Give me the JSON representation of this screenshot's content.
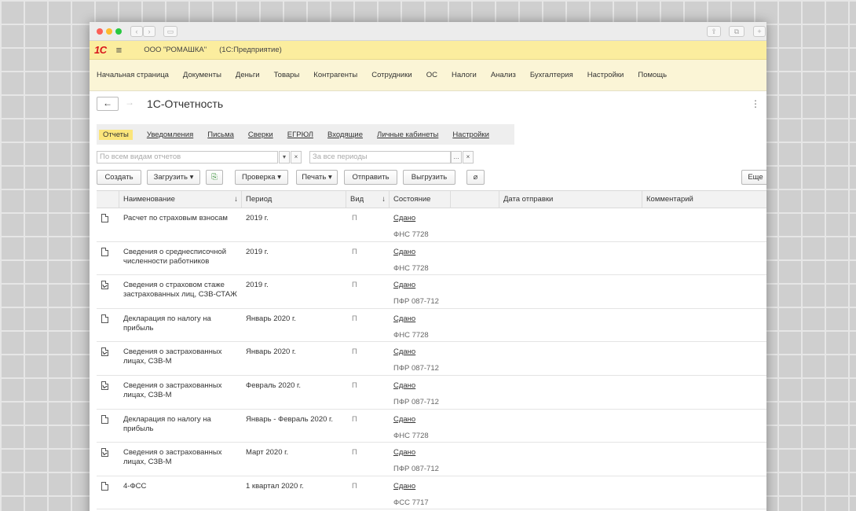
{
  "app": {
    "logo": "1С",
    "org": "ООО \"РОМАШКА\"",
    "platform": "(1С:Предприятие)"
  },
  "menu": [
    "Начальная страница",
    "Документы",
    "Деньги",
    "Товары",
    "Контрагенты",
    "Сотрудники",
    "ОС",
    "Налоги",
    "Анализ",
    "Бухгалтерия",
    "Настройки",
    "Помощь"
  ],
  "page": {
    "title": "1С-Отчетность"
  },
  "tabs": [
    "Отчеты",
    "Уведомления",
    "Письма",
    "Сверки",
    "ЕГРЮЛ",
    "Входящие",
    "Личные кабинеты",
    "Настройки"
  ],
  "filters": {
    "kind_placeholder": "По всем видам отчетов",
    "period_placeholder": "За все периоды"
  },
  "toolbar": {
    "create": "Создать",
    "load": "Загрузить",
    "check": "Проверка",
    "print": "Печать",
    "send": "Отправить",
    "export": "Выгрузить",
    "more": "Еще"
  },
  "columns": {
    "name": "Наименование",
    "period": "Период",
    "kind": "Вид",
    "state": "Состояние",
    "sent_date": "Дата отправки",
    "comment": "Комментарий"
  },
  "rows": [
    {
      "icon": "document-icon",
      "name": "Расчет по страховым взносам",
      "period": "2019 г.",
      "kind": "П",
      "status": "Сдано",
      "agency": "ФНС 7728"
    },
    {
      "icon": "document-icon",
      "name": "Сведения о среднесписочной численности работников",
      "period": "2019 г.",
      "kind": "П",
      "status": "Сдано",
      "agency": "ФНС 7728"
    },
    {
      "icon": "signed-document-icon",
      "name": "Сведения о страховом стаже застрахованных лиц, СЗВ-СТАЖ",
      "period": "2019 г.",
      "kind": "П",
      "status": "Сдано",
      "agency": "ПФР 087-712"
    },
    {
      "icon": "document-icon",
      "name": "Декларация по налогу на прибыль",
      "period": "Январь 2020 г.",
      "kind": "П",
      "status": "Сдано",
      "agency": "ФНС 7728"
    },
    {
      "icon": "signed-document-icon",
      "name": "Сведения о застрахованных лицах, СЗВ-М",
      "period": "Январь 2020 г.",
      "kind": "П",
      "status": "Сдано",
      "agency": "ПФР 087-712"
    },
    {
      "icon": "signed-document-icon",
      "name": "Сведения о застрахованных лицах, СЗВ-М",
      "period": "Февраль 2020 г.",
      "kind": "П",
      "status": "Сдано",
      "agency": "ПФР 087-712"
    },
    {
      "icon": "document-icon",
      "name": "Декларация по налогу на прибыль",
      "period": "Январь - Февраль 2020 г.",
      "kind": "П",
      "status": "Сдано",
      "agency": "ФНС 7728"
    },
    {
      "icon": "signed-document-icon",
      "name": "Сведения о застрахованных лицах, СЗВ-М",
      "period": "Март 2020 г.",
      "kind": "П",
      "status": "Сдано",
      "agency": "ПФР 087-712"
    },
    {
      "icon": "document-icon",
      "name": "4-ФСС",
      "period": "1 квартал 2020 г.",
      "kind": "П",
      "status": "Сдано",
      "agency": "ФСС 7717"
    }
  ]
}
